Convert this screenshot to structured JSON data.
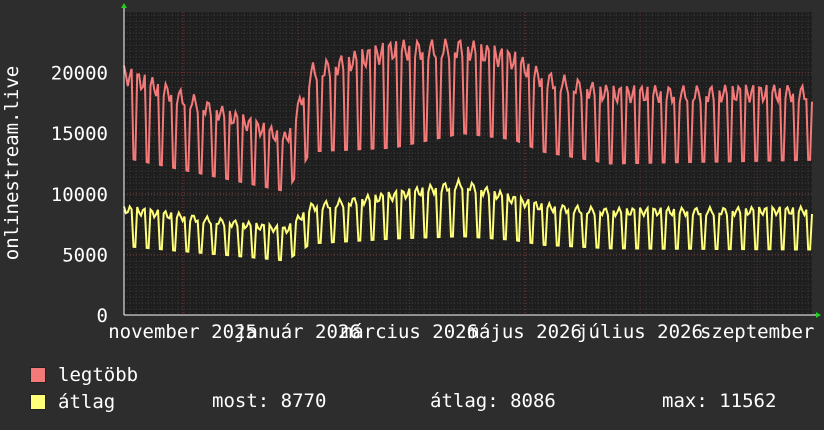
{
  "chart_data": {
    "type": "line",
    "ylabel": "onlinestream.live",
    "ylim": [
      0,
      25000
    ],
    "yticks": [
      0,
      5000,
      10000,
      15000,
      20000
    ],
    "x_tick_labels": [
      "november 2025",
      "január 2026",
      "március 2026",
      "május 2026",
      "július 2026",
      "szeptember"
    ],
    "x_tick_dates": [
      "2025-11-01",
      "2026-01-01",
      "2026-03-01",
      "2026-05-01",
      "2026-07-01",
      "2026-09-01"
    ],
    "x_range": [
      "2025-10-01",
      "2026-09-30"
    ],
    "grid": true,
    "series": [
      {
        "name": "legtöbb",
        "color": "#f47a7a",
        "weekly_high": 19500,
        "weekly_low": 13000,
        "segments": [
          {
            "from": "2025-10-01",
            "high": 19800,
            "low": 13000
          },
          {
            "from": "2025-12-26",
            "high": 14500,
            "low": 10200
          },
          {
            "from": "2026-01-08",
            "high": 20000,
            "low": 13500
          },
          {
            "from": "2026-02-20",
            "high": 21800,
            "low": 13800
          },
          {
            "from": "2026-03-29",
            "high": 22000,
            "low": 15000
          },
          {
            "from": "2026-04-25",
            "high": 21000,
            "low": 14500
          },
          {
            "from": "2026-05-10",
            "high": 19500,
            "low": 13500
          },
          {
            "from": "2026-06-15",
            "high": 18200,
            "low": 12500
          },
          {
            "from": "2026-09-30",
            "high": 18300,
            "low": 12800
          }
        ]
      },
      {
        "name": "átlag",
        "color": "#ffff7a",
        "segments": [
          {
            "from": "2025-10-01",
            "high": 8700,
            "low": 5700
          },
          {
            "from": "2025-12-26",
            "high": 7000,
            "low": 4500
          },
          {
            "from": "2026-01-08",
            "high": 8900,
            "low": 5900
          },
          {
            "from": "2026-02-20",
            "high": 9800,
            "low": 6300
          },
          {
            "from": "2026-03-29",
            "high": 10800,
            "low": 6500
          },
          {
            "from": "2026-04-25",
            "high": 9500,
            "low": 6200
          },
          {
            "from": "2026-05-10",
            "high": 8900,
            "low": 5800
          },
          {
            "from": "2026-06-15",
            "high": 8500,
            "low": 5500
          },
          {
            "from": "2026-09-30",
            "high": 8600,
            "low": 5400
          }
        ]
      }
    ]
  },
  "legend": {
    "max_label": "legtöbb",
    "avg_label": "átlag"
  },
  "stats": {
    "current": "most: 8770",
    "average": "átlag: 8086",
    "maximum": "max: 11562"
  }
}
